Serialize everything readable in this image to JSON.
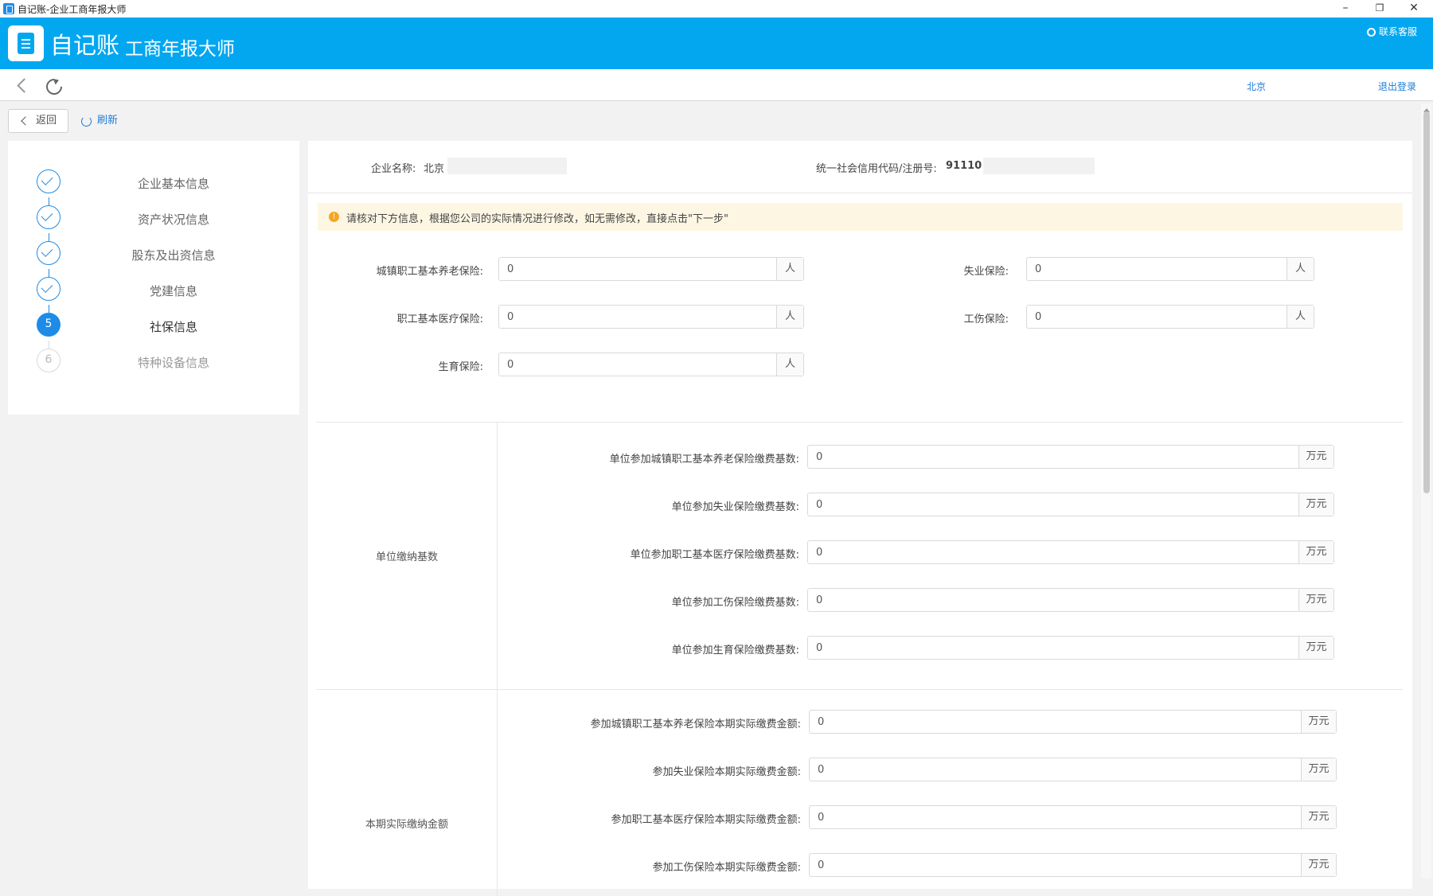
{
  "window": {
    "title": "自记账-企业工商年报大师",
    "minimize": "–",
    "restore": "❐",
    "close": "✕"
  },
  "header": {
    "brand": "自记账",
    "subbrand": "工商年报大师",
    "contact": "联系客服"
  },
  "nav": {
    "region": "北京",
    "logout": "退出登录"
  },
  "toolbar": {
    "return_label": "返回",
    "refresh_label": "刷新"
  },
  "steps": [
    {
      "label": "企业基本信息",
      "status": "done"
    },
    {
      "label": "资产状况信息",
      "status": "done"
    },
    {
      "label": "股东及出资信息",
      "status": "done"
    },
    {
      "label": "党建信息",
      "status": "done"
    },
    {
      "label": "社保信息",
      "status": "active",
      "number": "5"
    },
    {
      "label": "特种设备信息",
      "status": "todo",
      "number": "6"
    }
  ],
  "company": {
    "name_label": "企业名称:",
    "name_value": "北京",
    "code_label": "统一社会信用代码/注册号:",
    "code_value": "91110"
  },
  "notice": {
    "text": "请核对下方信息，根据您公司的实际情况进行修改，如无需修改，直接点击\"下一步\""
  },
  "insured_counts": {
    "pension": {
      "label": "城镇职工基本养老保险:",
      "value": "0",
      "unit": "人"
    },
    "unemployment": {
      "label": "失业保险:",
      "value": "0",
      "unit": "人"
    },
    "medical": {
      "label": "职工基本医疗保险:",
      "value": "0",
      "unit": "人"
    },
    "injury": {
      "label": "工伤保险:",
      "value": "0",
      "unit": "人"
    },
    "maternity": {
      "label": "生育保险:",
      "value": "0",
      "unit": "人"
    }
  },
  "contribution_base": {
    "section_label": "单位缴纳基数",
    "items": [
      {
        "label": "单位参加城镇职工基本养老保险缴费基数:",
        "value": "0",
        "unit": "万元"
      },
      {
        "label": "单位参加失业保险缴费基数:",
        "value": "0",
        "unit": "万元"
      },
      {
        "label": "单位参加职工基本医疗保险缴费基数:",
        "value": "0",
        "unit": "万元"
      },
      {
        "label": "单位参加工伤保险缴费基数:",
        "value": "0",
        "unit": "万元"
      },
      {
        "label": "单位参加生育保险缴费基数:",
        "value": "0",
        "unit": "万元"
      }
    ]
  },
  "actual_paid": {
    "section_label": "本期实际缴纳金额",
    "items": [
      {
        "label": "参加城镇职工基本养老保险本期实际缴费金额:",
        "value": "0",
        "unit": "万元"
      },
      {
        "label": "参加失业保险本期实际缴费金额:",
        "value": "0",
        "unit": "万元"
      },
      {
        "label": "参加职工基本医疗保险本期实际缴费金额:",
        "value": "0",
        "unit": "万元"
      },
      {
        "label": "参加工伤保险本期实际缴费金额:",
        "value": "0",
        "unit": "万元"
      }
    ]
  },
  "colors": {
    "brand": "#02a7f0",
    "primary": "#1e8ce6",
    "link": "#1e7cd7",
    "notice_bg": "#fdf6e3",
    "notice_icon": "#f5a623"
  }
}
